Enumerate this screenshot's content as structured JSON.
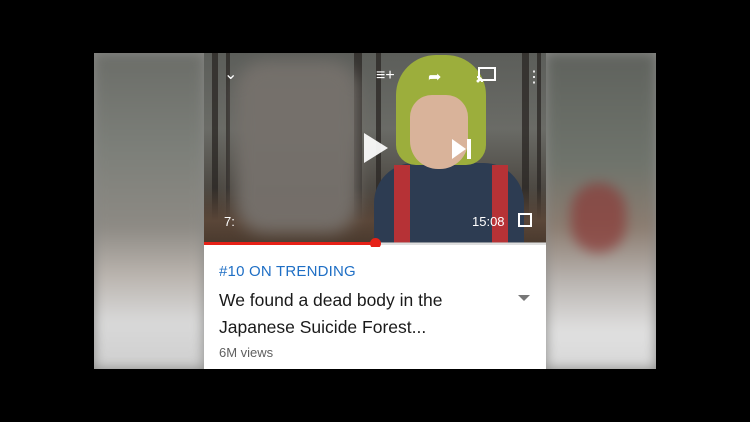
{
  "player": {
    "current_time": "7:",
    "duration": "15:08",
    "progress_fraction": 0.5,
    "icons": [
      "chevron-down-icon",
      "add-to-queue-icon",
      "share-icon",
      "cast-icon",
      "more-vert-icon",
      "play-icon",
      "skip-next-icon",
      "fullscreen-icon"
    ]
  },
  "video_info": {
    "trending_label": "#10 ON TRENDING",
    "title": "We found a dead body in the Japanese Suicide Forest...",
    "views": "6M views"
  },
  "colors": {
    "accent_red": "#e62117",
    "trending_blue": "#1f6fc5"
  }
}
